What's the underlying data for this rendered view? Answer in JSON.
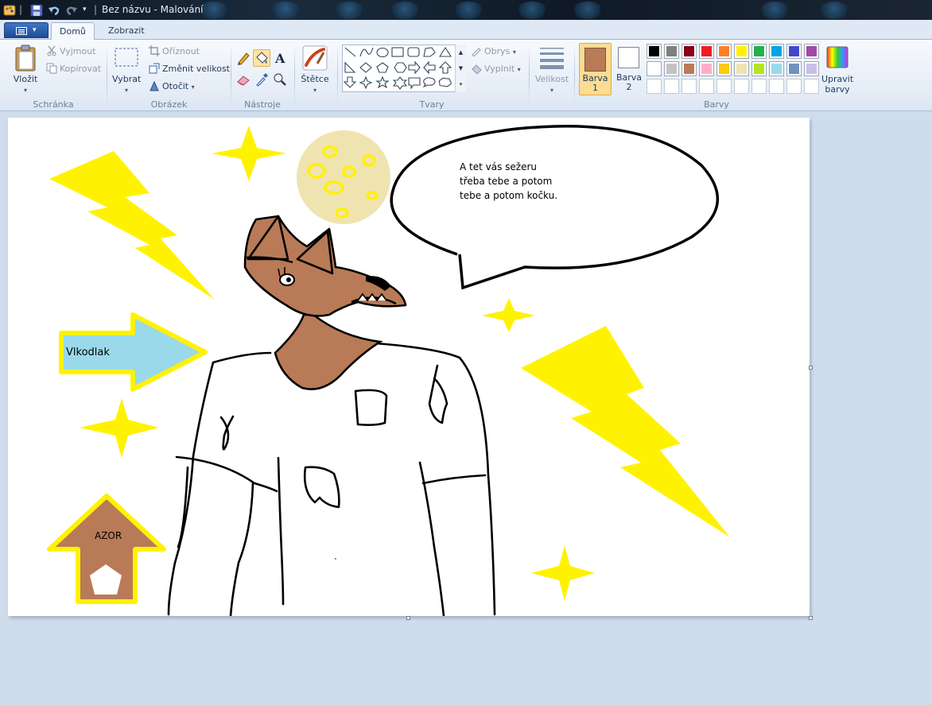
{
  "window": {
    "title": "Bez názvu - Malování"
  },
  "tabs": [
    {
      "label": "Domů",
      "active": true
    },
    {
      "label": "Zobrazit",
      "active": false
    }
  ],
  "clipboard": {
    "paste": "Vložit",
    "cut": "Vyjmout",
    "copy": "Kopírovat",
    "group": "Schránka"
  },
  "image": {
    "select": "Vybrat",
    "crop": "Oříznout",
    "resize": "Změnit velikost",
    "rotate": "Otočit",
    "group": "Obrázek"
  },
  "tools": {
    "group": "Nástroje",
    "text_tool_glyph": "A",
    "selected": "fill-tool"
  },
  "brushes": {
    "label": "Štětce"
  },
  "shapes": {
    "outline": "Obrys",
    "fill": "Vyplnit",
    "group": "Tvary"
  },
  "size": {
    "label": "Velikost"
  },
  "colors": {
    "color1": "Barva",
    "color1_num": "1",
    "color2": "Barva",
    "color2_num": "2",
    "edit_line1": "Upravit",
    "edit_line2": "barvy",
    "group": "Barvy",
    "color1_value": "#b97a57",
    "color2_value": "#ffffff",
    "palette_row1": [
      "#000000",
      "#7f7f7f",
      "#880015",
      "#ed1c24",
      "#ff7f27",
      "#fff200",
      "#22b14c",
      "#00a2e8",
      "#3f48cc",
      "#a349a4"
    ],
    "palette_row2": [
      "#ffffff",
      "#c3c3c3",
      "#b97a57",
      "#ffaec9",
      "#ffc90e",
      "#efe4b0",
      "#b5e61d",
      "#99d9ea",
      "#7092be",
      "#c8bfe7"
    ]
  },
  "canvas": {
    "speech_line1": "A tet vás sežeru",
    "speech_line2": "třeba tebe a potom",
    "speech_line3": "tebe a potom kočku.",
    "arrow_label": "Vlkodlak",
    "up_arrow_label": "AZOR"
  }
}
